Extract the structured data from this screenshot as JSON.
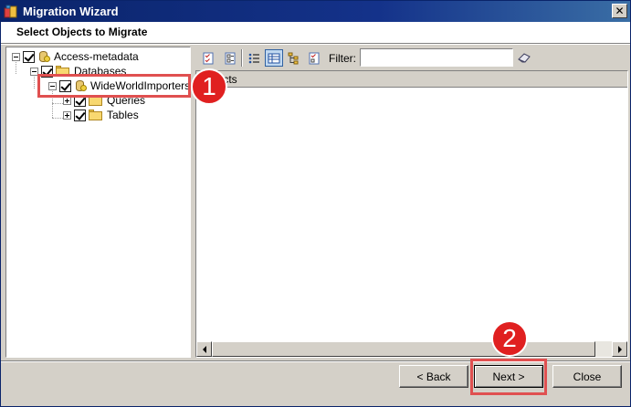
{
  "window": {
    "title": "Migration Wizard",
    "close_glyph": "✕"
  },
  "header": {
    "title": "Select Objects to Migrate"
  },
  "tree": {
    "root": {
      "label": "Access-metadata",
      "checked": true
    },
    "databases": {
      "label": "Databases",
      "checked": true
    },
    "db": {
      "label": "WideWorldImporters",
      "checked": true
    },
    "queries": {
      "label": "Queries",
      "checked": true
    },
    "tables": {
      "label": "Tables",
      "checked": true
    }
  },
  "toolbar": {
    "filter_label": "Filter:",
    "filter_value": "",
    "buttons": [
      "check-all-icon",
      "uncheck-all-icon",
      "list-view-icon",
      "details-view-icon",
      "tree-view-icon",
      "properties-icon"
    ]
  },
  "list": {
    "header": "Objects"
  },
  "buttons": {
    "back": "< Back",
    "next": "Next >",
    "close": "Close"
  },
  "callouts": {
    "one": "1",
    "two": "2"
  },
  "colors": {
    "accent": "#0a246a",
    "callout": "#e02020"
  }
}
